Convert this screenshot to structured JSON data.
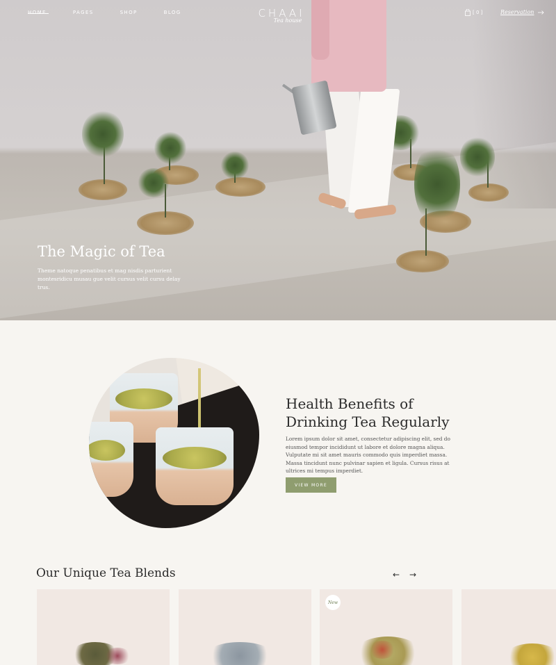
{
  "nav": {
    "items": [
      {
        "label": "HOME",
        "active": true
      },
      {
        "label": "PAGES",
        "active": false
      },
      {
        "label": "SHOP",
        "active": false
      },
      {
        "label": "BLOG",
        "active": false
      }
    ]
  },
  "logo": {
    "main": "CHAAI",
    "sub": "Tea house"
  },
  "cart": {
    "count": "[ 0 ]",
    "icon": "shopping-bag-icon"
  },
  "reservation": {
    "label": "Reservation",
    "icon": "arrow-right-icon"
  },
  "hero": {
    "title": "The Magic of Tea",
    "text": "Theme natoque penatibus et mag nisdis parturient montesridicu musau gue velit cursus velit cursu delay trus."
  },
  "health": {
    "title": "Health Benefits of Drinking Tea Regularly",
    "text": "Lorem ipsum dolor sit amet, consectetur adipiscing elit, sed do eiusmod tempor incididunt ut labore et dolore magna aliqua. Vulputate mi sit amet mauris commodo quis imperdiet massa. Massa tincidunt nunc pulvinar sapien et ligula. Cursus risus at ultrices mi tempus imperdiet.",
    "button": "VIEW MORE"
  },
  "blends": {
    "title": "Our Unique Tea Blends",
    "prev_icon": "arrow-left-icon",
    "next_icon": "arrow-right-icon",
    "prev_glyph": "←",
    "next_glyph": "→",
    "badge": "New"
  },
  "colors": {
    "accent": "#8f9d6f",
    "background": "#f7f5f1",
    "card": "#f1e8e3"
  }
}
